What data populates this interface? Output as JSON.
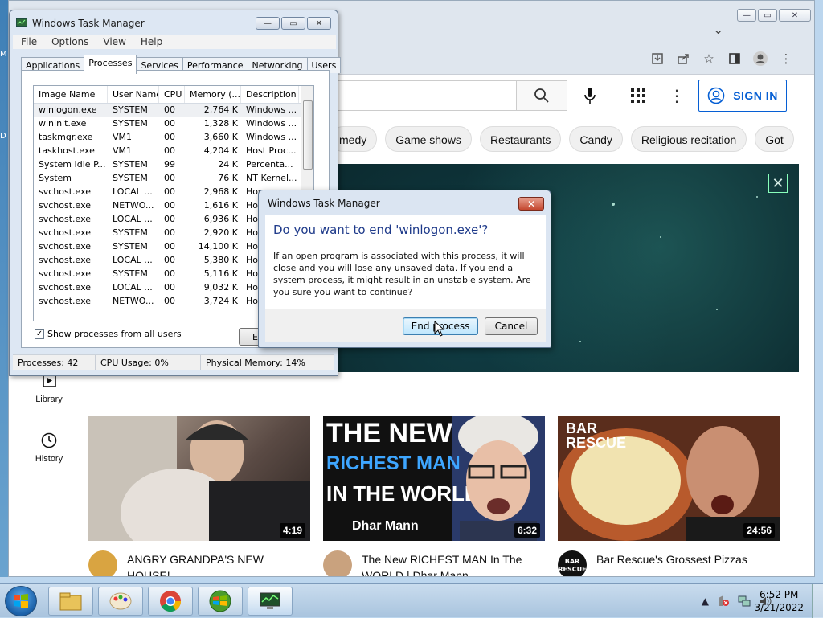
{
  "desktop": {
    "marks": [
      "M",
      "D"
    ]
  },
  "chrome": {
    "window_controls": [
      "minimize",
      "maximize",
      "close"
    ],
    "toolbar_icons": [
      "install-icon",
      "share-icon",
      "star-icon",
      "sidebar-icon",
      "profile-icon",
      "menu-icon"
    ]
  },
  "youtube": {
    "sign_in": "SIGN IN",
    "chips": [
      "medy",
      "Game shows",
      "Restaurants",
      "Candy",
      "Religious recitation",
      "Got"
    ],
    "sidebar": [
      {
        "label": "Library"
      },
      {
        "label": "History"
      }
    ],
    "videos": [
      {
        "title_line1": "ANGRY GRANDPA'S NEW",
        "title_line2": "HOUSE!",
        "duration": "4:19"
      },
      {
        "title_line1": "The New RICHEST MAN In The",
        "title_line2": "WORLD | Dhar Mann",
        "duration": "6:32",
        "thumb_text": [
          "THE NEW",
          "RICHEST MAN",
          "IN THE WORLD"
        ],
        "thumb_badge": "Dhar Mann"
      },
      {
        "title_line1": "Bar Rescue's Grossest Pizzas",
        "title_line2": "",
        "duration": "24:56",
        "thumb_text": [
          "BAR",
          "RESCUE"
        ],
        "avatar_text": [
          "BAR",
          "RESCUE"
        ]
      }
    ]
  },
  "task_manager": {
    "title": "Windows Task Manager",
    "menu": [
      "File",
      "Options",
      "View",
      "Help"
    ],
    "tabs": [
      "Applications",
      "Processes",
      "Services",
      "Performance",
      "Networking",
      "Users"
    ],
    "active_tab": "Processes",
    "columns": [
      "Image Name",
      "User Name",
      "CPU",
      "Memory (...",
      "Description"
    ],
    "rows": [
      [
        "winlogon.exe",
        "SYSTEM",
        "00",
        "2,764 K",
        "Windows ..."
      ],
      [
        "wininit.exe",
        "SYSTEM",
        "00",
        "1,328 K",
        "Windows ..."
      ],
      [
        "taskmgr.exe",
        "VM1",
        "00",
        "3,660 K",
        "Windows ..."
      ],
      [
        "taskhost.exe",
        "VM1",
        "00",
        "4,204 K",
        "Host Proc..."
      ],
      [
        "System Idle P...",
        "SYSTEM",
        "99",
        "24 K",
        "Percenta..."
      ],
      [
        "System",
        "SYSTEM",
        "00",
        "76 K",
        "NT Kernel..."
      ],
      [
        "svchost.exe",
        "LOCAL ...",
        "00",
        "2,968 K",
        "Hos"
      ],
      [
        "svchost.exe",
        "NETWO...",
        "00",
        "1,616 K",
        "Hos"
      ],
      [
        "svchost.exe",
        "LOCAL ...",
        "00",
        "6,936 K",
        "Hos"
      ],
      [
        "svchost.exe",
        "SYSTEM",
        "00",
        "2,920 K",
        "Hos"
      ],
      [
        "svchost.exe",
        "SYSTEM",
        "00",
        "14,100 K",
        "Hos"
      ],
      [
        "svchost.exe",
        "LOCAL ...",
        "00",
        "5,380 K",
        "Hos"
      ],
      [
        "svchost.exe",
        "SYSTEM",
        "00",
        "5,116 K",
        "Hos"
      ],
      [
        "svchost.exe",
        "LOCAL ...",
        "00",
        "9,032 K",
        "Hos"
      ],
      [
        "svchost.exe",
        "NETWO...",
        "00",
        "3,724 K",
        "Hos"
      ]
    ],
    "show_all_label": "Show processes from all users",
    "end_button_partial": "E",
    "status": {
      "processes": "Processes: 42",
      "cpu": "CPU Usage: 0%",
      "memory": "Physical Memory: 14%"
    }
  },
  "dialog": {
    "title": "Windows Task Manager",
    "question": "Do you want to end 'winlogon.exe'?",
    "message": "If an open program is associated with this process, it will close and you will lose any unsaved data. If you end a system process, it might result in an unstable system. Are you sure you want to continue?",
    "confirm_label": "End process",
    "cancel_label": "Cancel"
  },
  "taskbar": {
    "apps": [
      "explorer-icon",
      "paint-icon",
      "chrome-icon",
      "media-center-icon",
      "task-manager-icon"
    ],
    "tray_arrow": "▲",
    "time": "6:52 PM",
    "date": "3/21/2022"
  }
}
